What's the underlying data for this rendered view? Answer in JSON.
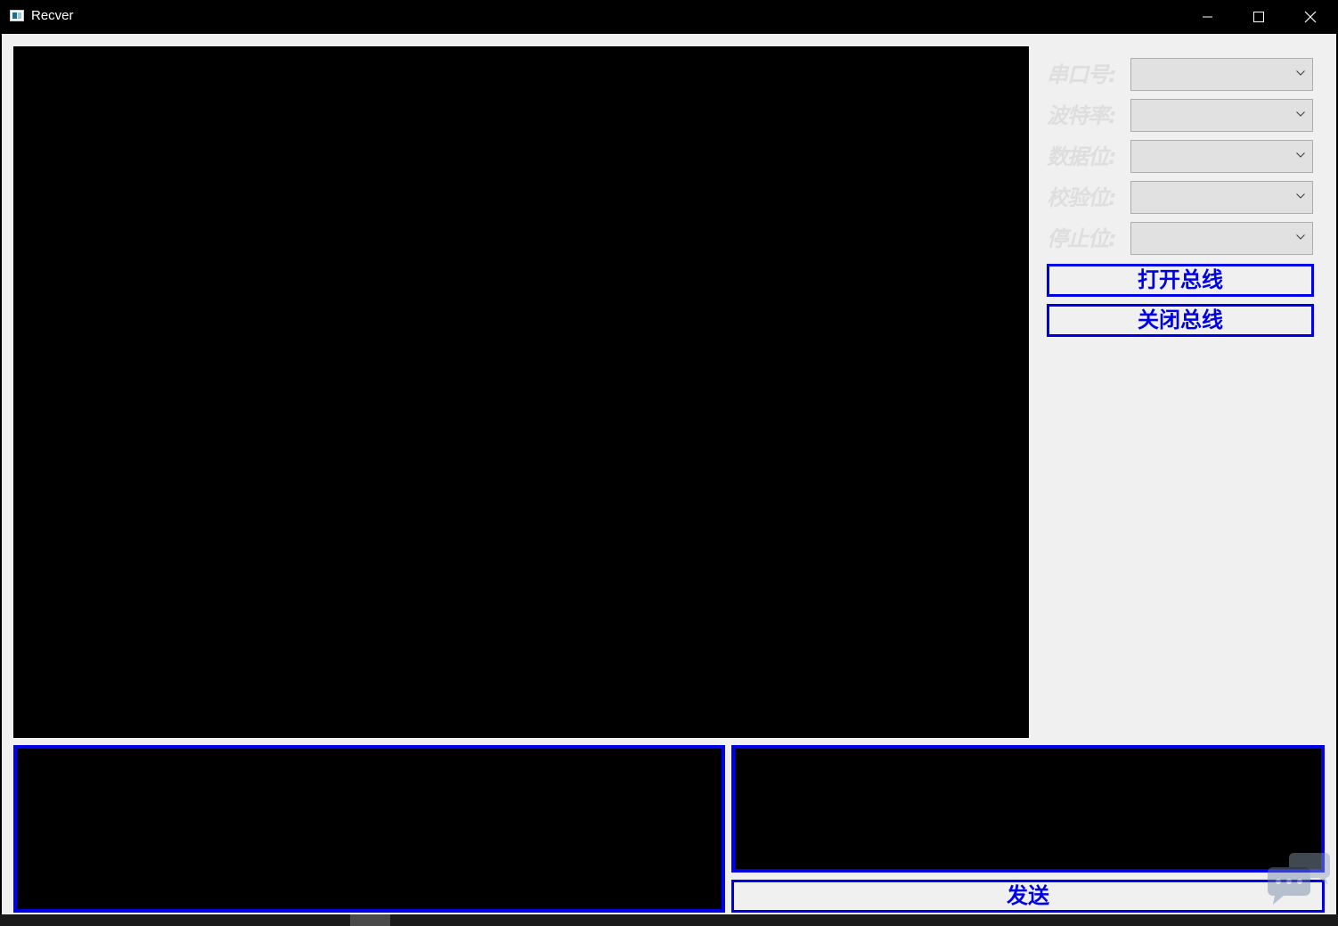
{
  "window": {
    "title": "Recver",
    "controls": {
      "minimize": "minimize-icon",
      "maximize": "maximize-icon",
      "close": "close-icon"
    }
  },
  "serial_settings": {
    "fields": [
      {
        "label": "串口号:",
        "value": ""
      },
      {
        "label": "波特率:",
        "value": ""
      },
      {
        "label": "数据位:",
        "value": ""
      },
      {
        "label": "校验位:",
        "value": ""
      },
      {
        "label": "停止位:",
        "value": ""
      }
    ]
  },
  "buttons": {
    "open_bus": "打开总线",
    "close_bus": "关闭总线",
    "send": "发送"
  },
  "receive_area": {
    "text": ""
  },
  "send_area": {
    "text": ""
  },
  "colors": {
    "accent": "#0000e6",
    "panel": "#f0f0f0",
    "display": "#000000",
    "label": "#dedede"
  }
}
